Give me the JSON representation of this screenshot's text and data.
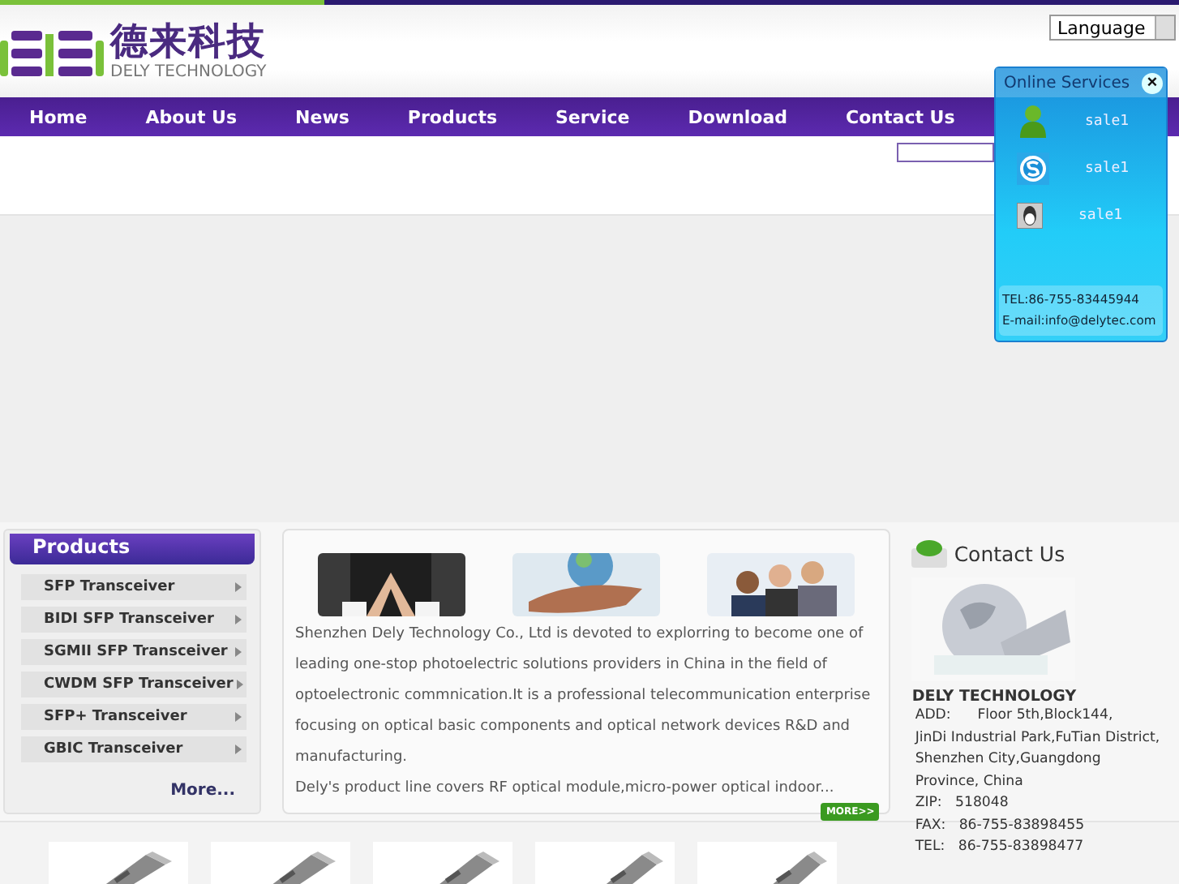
{
  "header": {
    "logo_cn": "德来科技",
    "logo_en": "DELY TECHNOLOGY",
    "language": "Language"
  },
  "nav": [
    "Home",
    "About Us",
    "News",
    "Products",
    "Service",
    "Download",
    "Contact Us"
  ],
  "online_services": {
    "title": "Online Services",
    "close": "×",
    "contacts": [
      {
        "kind": "messenger",
        "label": "sale1"
      },
      {
        "kind": "skype",
        "label": "sale1"
      },
      {
        "kind": "qq",
        "label": "sale1"
      }
    ],
    "tel": "TEL:86-755-83445944",
    "email": "E-mail:info@delytec.com"
  },
  "products": {
    "title": "Products",
    "items": [
      "SFP Transceiver",
      "BIDI SFP Transceiver",
      "SGMII SFP Transceiver",
      "CWDM SFP Transceiver",
      "SFP+ Transceiver",
      "GBIC Transceiver"
    ],
    "more": "More..."
  },
  "about": {
    "text": "Shenzhen Dely Technology Co., Ltd is devoted to explorring to become one of leading one-stop photoelectric solutions providers in China in the field of optoelectronic commnication.It is a professional telecommunication enterprise focusing on optical basic components and optical network devices R&D and manufacturing.",
    "summary": "Dely's product line covers RF optical module,micro-power optical indoor...",
    "more": "MORE>>"
  },
  "contact": {
    "title": "Contact Us",
    "company": "DELY TECHNOLOGY",
    "lines": [
      "ADD:      Floor 5th,Block144,",
      "JinDi Industrial Park,FuTian District,",
      "Shenzhen City,Guangdong",
      "Province, China",
      "ZIP:   518048",
      "FAX:   86-755-83898455",
      "TEL:   86-755-83898477"
    ]
  }
}
